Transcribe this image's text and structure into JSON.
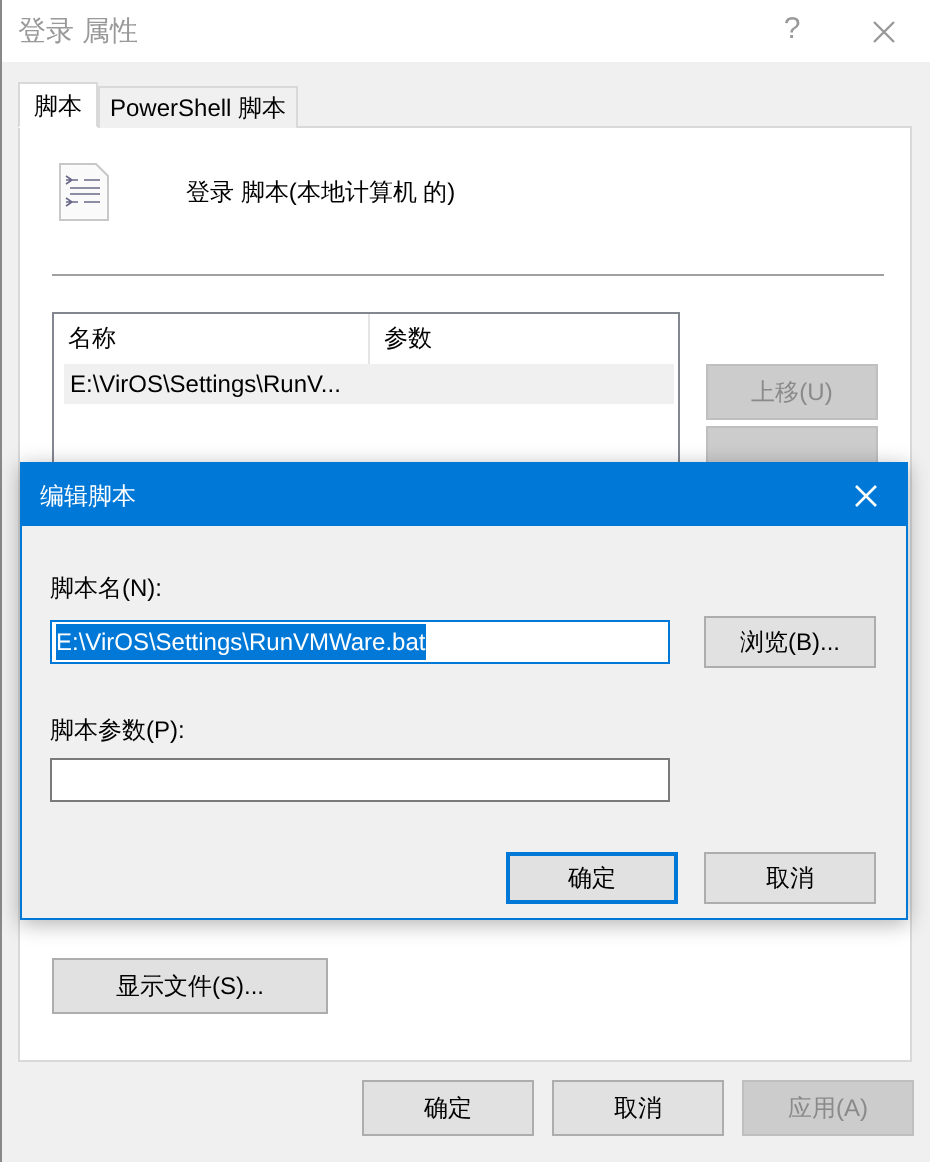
{
  "window": {
    "title": "登录 属性",
    "help": "?"
  },
  "tabs": [
    {
      "label": "脚本",
      "selected": true
    },
    {
      "label": "PowerShell 脚本",
      "selected": false
    }
  ],
  "heading": "登录 脚本(本地计算机 的)",
  "list": {
    "columns": [
      "名称",
      "参数"
    ],
    "rows": [
      {
        "cells": [
          "E:\\VirOS\\Settings\\RunV..."
        ],
        "selected": true
      }
    ]
  },
  "side_buttons": [
    {
      "label": "上移(U)",
      "disabled": true
    },
    {
      "disabled": true
    }
  ],
  "show_files_button": "显示文件(S)...",
  "footer_buttons": [
    {
      "label": "确定",
      "disabled": false
    },
    {
      "label": "取消",
      "disabled": false
    },
    {
      "label": "应用(A)",
      "disabled": true
    }
  ],
  "edit_dialog": {
    "title": "编辑脚本",
    "fields": [
      {
        "label": "脚本名(N):",
        "value": "E:\\VirOS\\Settings\\RunVMWare.bat",
        "selected": true
      },
      {
        "label": "脚本参数(P):",
        "selected": false
      }
    ],
    "browse_button": "浏览(B)...",
    "buttons": [
      {
        "label": "确定",
        "default": true
      },
      {
        "label": "取消",
        "default": false
      }
    ]
  }
}
